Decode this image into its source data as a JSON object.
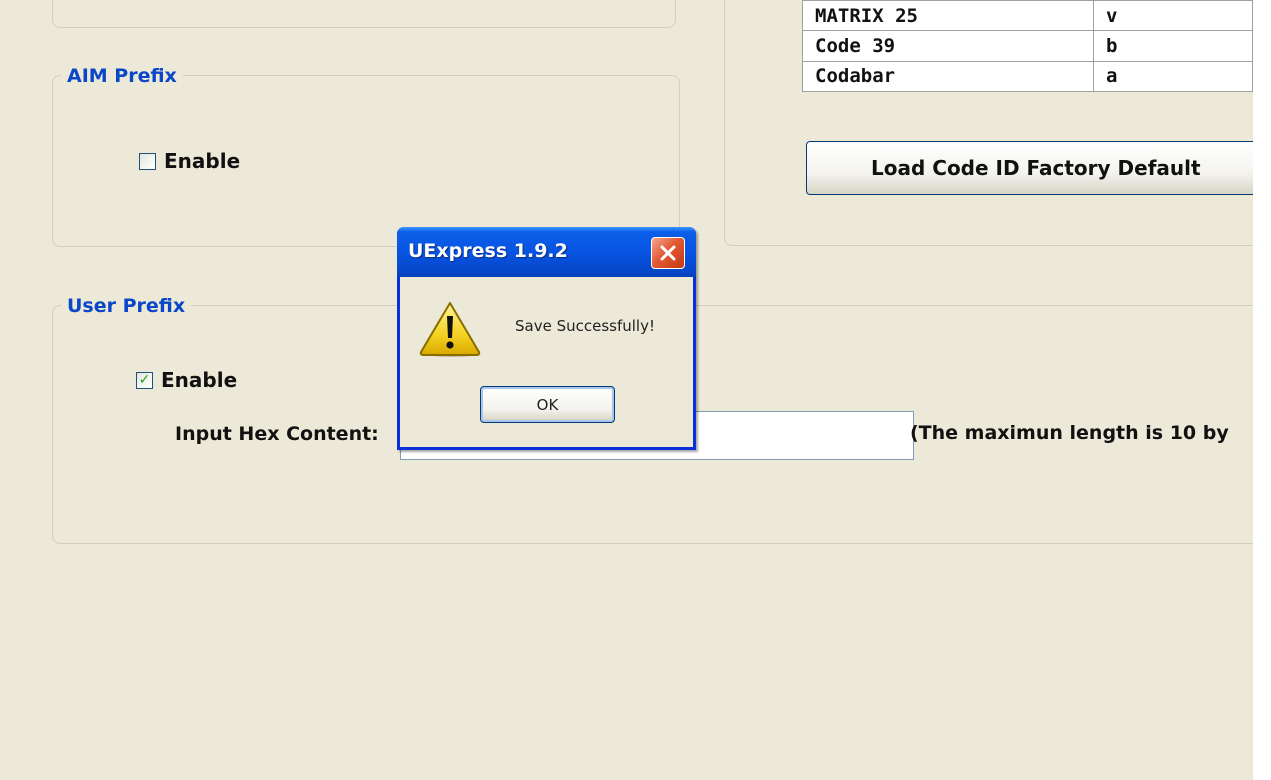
{
  "aim_prefix": {
    "title": "AIM Prefix",
    "enable_label": "Enable",
    "enabled": false
  },
  "user_prefix": {
    "title": "User Prefix",
    "enable_label": "Enable",
    "enabled": true,
    "input_label": "Input Hex Content:",
    "input_value": "",
    "hint": "(The maximun length is 10 by"
  },
  "code_id_table": {
    "rows": [
      {
        "name": "MATRIX 25",
        "code": "v"
      },
      {
        "name": "Code 39",
        "code": "b"
      },
      {
        "name": "Codabar",
        "code": "a"
      }
    ]
  },
  "load_default_button": "Load Code ID Factory Default",
  "dialog": {
    "title": "UExpress 1.9.2",
    "message": "Save Successfully!",
    "ok_label": "OK",
    "icon": "warning-icon",
    "close_icon": "close-icon"
  },
  "colors": {
    "window_bg": "#ece9d8",
    "group_title": "#0a46c8",
    "dialog_titlebar": "#0854e3",
    "close_button": "#e25a33",
    "checkmark": "#21a121"
  }
}
